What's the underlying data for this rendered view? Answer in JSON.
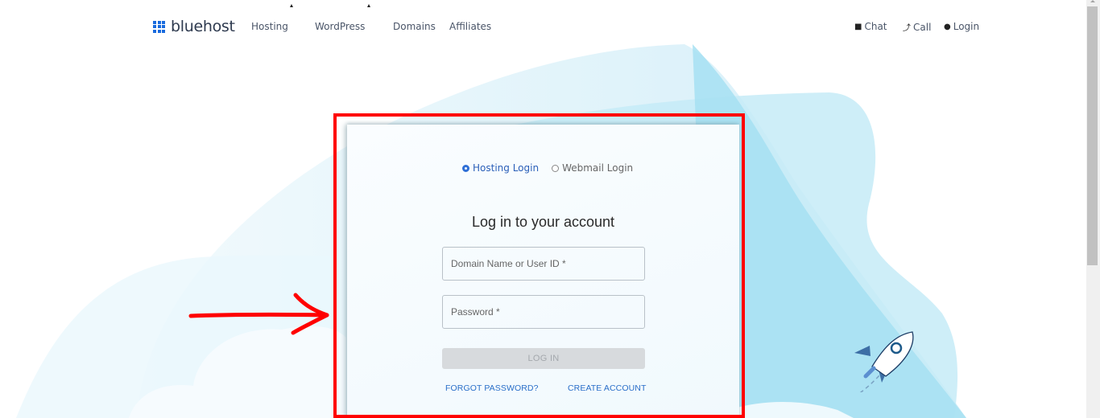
{
  "header": {
    "logo_text": "bluehost",
    "nav": [
      {
        "label": "Hosting",
        "has_dropdown": true
      },
      {
        "label": "WordPress",
        "has_dropdown": true
      },
      {
        "label": "Domains",
        "has_dropdown": false
      },
      {
        "label": "Affiliates",
        "has_dropdown": false
      }
    ],
    "right_nav": [
      {
        "label": "Chat",
        "icon": "chat-icon"
      },
      {
        "label": "Call",
        "icon": "phone-icon"
      },
      {
        "label": "Login",
        "icon": "user-icon"
      }
    ]
  },
  "login": {
    "login_types": [
      {
        "label": "Hosting Login",
        "selected": true
      },
      {
        "label": "Webmail Login",
        "selected": false
      }
    ],
    "title": "Log in to your account",
    "username": {
      "value": "",
      "placeholder": "Domain Name or User ID *"
    },
    "password": {
      "value": "",
      "placeholder": "Password *"
    },
    "submit_label": "LOG IN",
    "forgot_label": "FORGOT PASSWORD?",
    "create_label": "CREATE ACCOUNT"
  },
  "annotation": {
    "highlight_color": "#ff0000"
  },
  "colors": {
    "brand": "#196bde",
    "link": "#2a6fc9",
    "sky": "#a6e1f2"
  }
}
